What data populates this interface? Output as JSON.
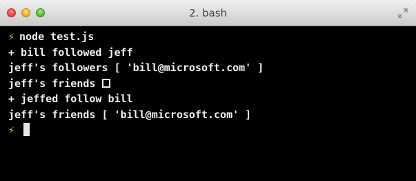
{
  "window": {
    "title": "2. bash"
  },
  "terminal": {
    "prompt_symbol": "⚡",
    "lines": [
      {
        "text": "node test.js"
      },
      {
        "text": "+ bill followed jeff"
      },
      {
        "text": "jeff's followers [ 'bill@microsoft.com' ]"
      },
      {
        "text": "jeff's friends "
      },
      {
        "text": "+ jeffed follow bill"
      },
      {
        "text": "jeff's friends [ 'bill@microsoft.com' ]"
      }
    ]
  },
  "colors": {
    "terminal_background": "#000000",
    "text": "#f2f2f2",
    "prompt": "#e8c23a"
  },
  "icons": {
    "close": "close-traffic-light-icon",
    "minimize": "minimize-traffic-light-icon",
    "zoom": "zoom-traffic-light-icon",
    "fullscreen": "fullscreen-arrows-icon"
  }
}
